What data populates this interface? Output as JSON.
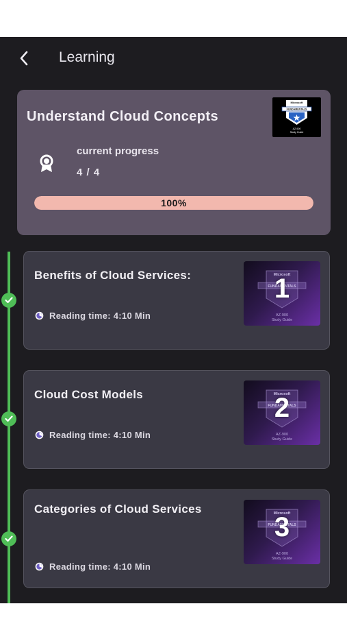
{
  "header": {
    "title": "Learning"
  },
  "course": {
    "title": "Understand Cloud Concepts",
    "progress_label": "current progress",
    "progress_count": "4 / 4",
    "progress_percent_text": "100%",
    "progress_value": 1.0,
    "thumbnail_text": {
      "top": "Microsoft",
      "band": "FUNDAMENTALS",
      "bottom1": "AZ-900",
      "bottom2": "Study Guide"
    }
  },
  "lessons": [
    {
      "title": "Benefits of Cloud Services:",
      "reading_time": "Reading time: 4:10 Min",
      "number": "1",
      "completed": true
    },
    {
      "title": "Cloud Cost Models",
      "reading_time": "Reading time: 4:10 Min",
      "number": "2",
      "completed": true
    },
    {
      "title": "Categories of Cloud Services",
      "reading_time": "Reading time: 4:10 Min",
      "number": "3",
      "completed": true
    }
  ],
  "lesson_thumbnail_text": {
    "top": "Microsoft",
    "band": "FUNDAMENTALS",
    "bottom1": "AZ-900",
    "bottom2": "Study Guide"
  },
  "colors": {
    "accent_green": "#4fbd57",
    "progress_fill": "#f2b8ae",
    "card_bg": "#5e5466",
    "lesson_bg": "#3a3944"
  },
  "icons": {
    "back": "chevron-left-icon",
    "award": "award-ribbon-icon",
    "clock": "clock-icon",
    "check": "check-icon"
  }
}
